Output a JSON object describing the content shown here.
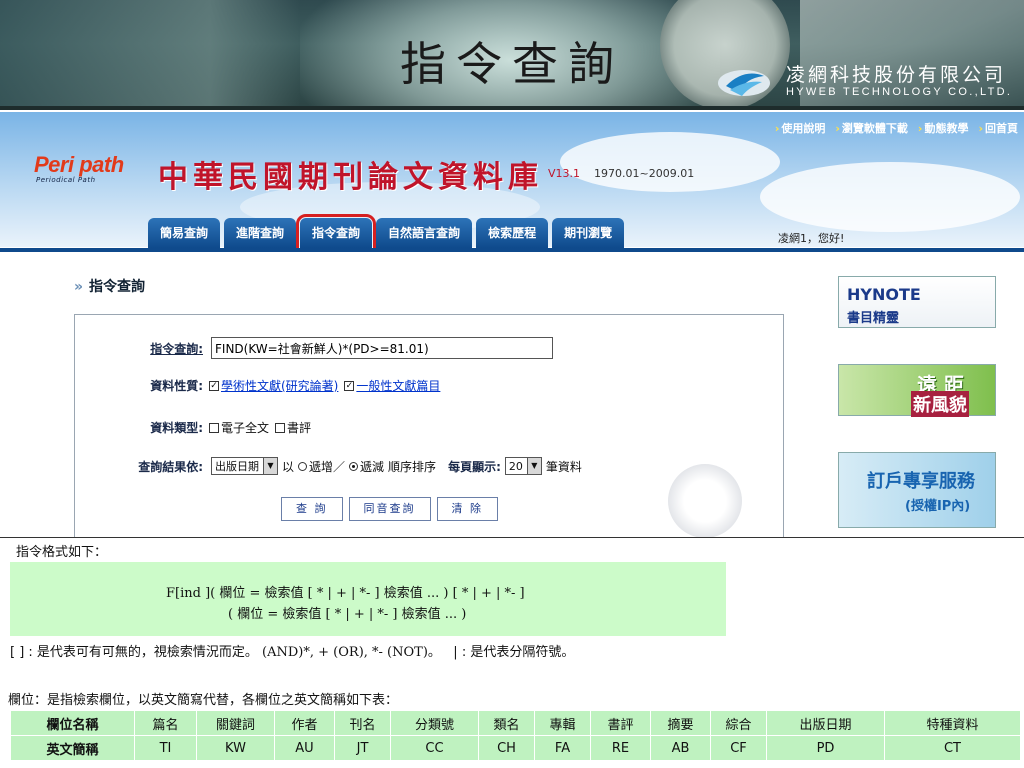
{
  "slide": {
    "title": "指令查詢",
    "company_name": "凌網科技股份有限公司",
    "company_eng": "HYWEB TECHNOLOGY CO.,LTD."
  },
  "site": {
    "logo_text": "Peri path",
    "logo_sub": "Periodical Path",
    "title": "中華民國期刊論文資料庫",
    "version": "V13.1",
    "range": "1970.01~2009.01",
    "top_links": [
      "使用說明",
      "瀏覽軟體下載",
      "動態教學",
      "回首頁"
    ],
    "tabs": [
      "簡易查詢",
      "進階查詢",
      "指令查詢",
      "自然語言查詢",
      "檢索歷程",
      "期刊瀏覽"
    ],
    "active_tab": "指令查詢",
    "greeting": "凌網1，您好!"
  },
  "form": {
    "section_title": "指令查詢",
    "cmd_label": "指令查詢:",
    "cmd_value": "FIND(KW=社會新鮮人)*(PD>=81.01)",
    "nature_label": "資料性質:",
    "nature_opt1": "學術性文獻(研究論著)",
    "nature_opt2": "一般性文獻篇目",
    "type_label": "資料類型:",
    "type_opt1": "電子全文",
    "type_opt2": "書評",
    "sort_label": "查詢結果依:",
    "sort_value": "出版日期",
    "sort_by": "以",
    "asc": "遞增／",
    "desc": "遞減",
    "sort_suffix": "順序排序",
    "per_page_label": "每頁顯示:",
    "per_page_value": "20",
    "per_page_unit": "筆資料",
    "buttons": [
      "查 詢",
      "同音查詢",
      "清 除"
    ]
  },
  "ads": {
    "ad1_line1": "HYNOTE",
    "ad1_line2": "書目精靈",
    "ad2_line1": "遠 距",
    "ad2_line2": "新風貌",
    "ad3_line1": "訂戶專享服務",
    "ad3_line2": "(授權IP內)"
  },
  "explain": {
    "format_title": "指令格式如下：",
    "format_line1": "F[ind ]( 欄位 = 檢索值 [ * | + | *- ] 檢索值 ... ) [ * | + | *- ]",
    "format_line2": "( 欄位 = 檢索值 [ * | + | *- ] 檢索值 ... )",
    "note1_a": "[ ] : 是代表可有可無的，視檢索情況而定。",
    "note1_b": " (AND)*, + (OR), *- (NOT)。",
    "note1_c": "   | : 是代表分隔符號。",
    "note2": "欄位：是指檢索欄位，以英文簡寫代替，各欄位之英文簡稱如下表："
  },
  "fields_table": {
    "row1": [
      "欄位名稱",
      "篇名",
      "關鍵詞",
      "作者",
      "刊名",
      "分類號",
      "類名",
      "專輯",
      "書評",
      "摘要",
      "綜合",
      "出版日期",
      "特種資料"
    ],
    "row2": [
      "英文簡稱",
      "TI",
      "KW",
      "AU",
      "JT",
      "CC",
      "CH",
      "FA",
      "RE",
      "AB",
      "CF",
      "PD",
      "CT"
    ]
  },
  "colors": {
    "tab_blue": "#0f4a8c",
    "db_title_red": "#c0142a",
    "format_box_green": "#ccfbc9",
    "table_green": "#bff2c0",
    "active_outline": "#d62020"
  }
}
